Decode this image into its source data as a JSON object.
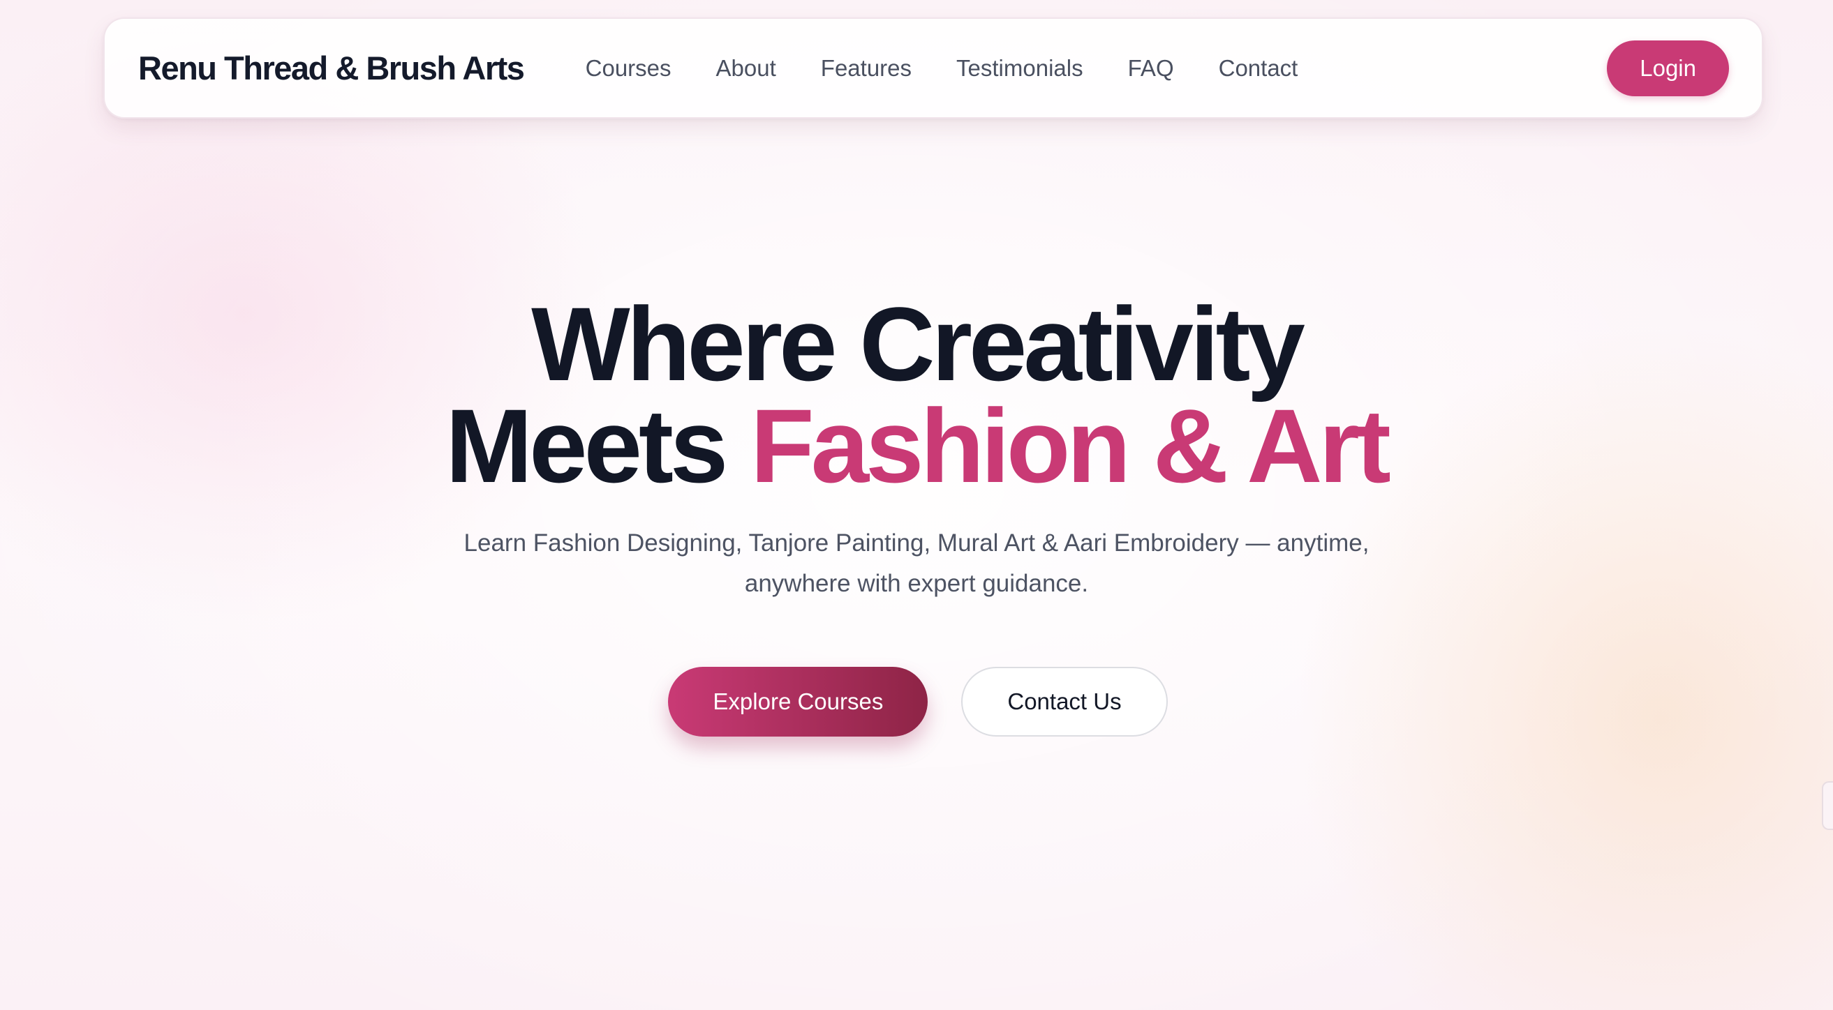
{
  "navbar": {
    "brand": "Renu Thread & Brush Arts",
    "links": [
      "Courses",
      "About",
      "Features",
      "Testimonials",
      "FAQ",
      "Contact"
    ],
    "login_label": "Login"
  },
  "hero": {
    "title_line1": "Where Creativity",
    "title_line2_plain": "Meets ",
    "title_line2_accent": "Fashion & Art",
    "subtitle": "Learn Fashion Designing, Tanjore Painting, Mural Art & Aari Embroidery — anytime, anywhere with expert guidance.",
    "primary_cta": "Explore Courses",
    "secondary_cta": "Contact Us"
  },
  "colors": {
    "accent": "#c93a75",
    "accent_dark": "#8e2446",
    "heading": "#121726",
    "body_text": "#4d5363",
    "background": "#fcf6f9"
  }
}
